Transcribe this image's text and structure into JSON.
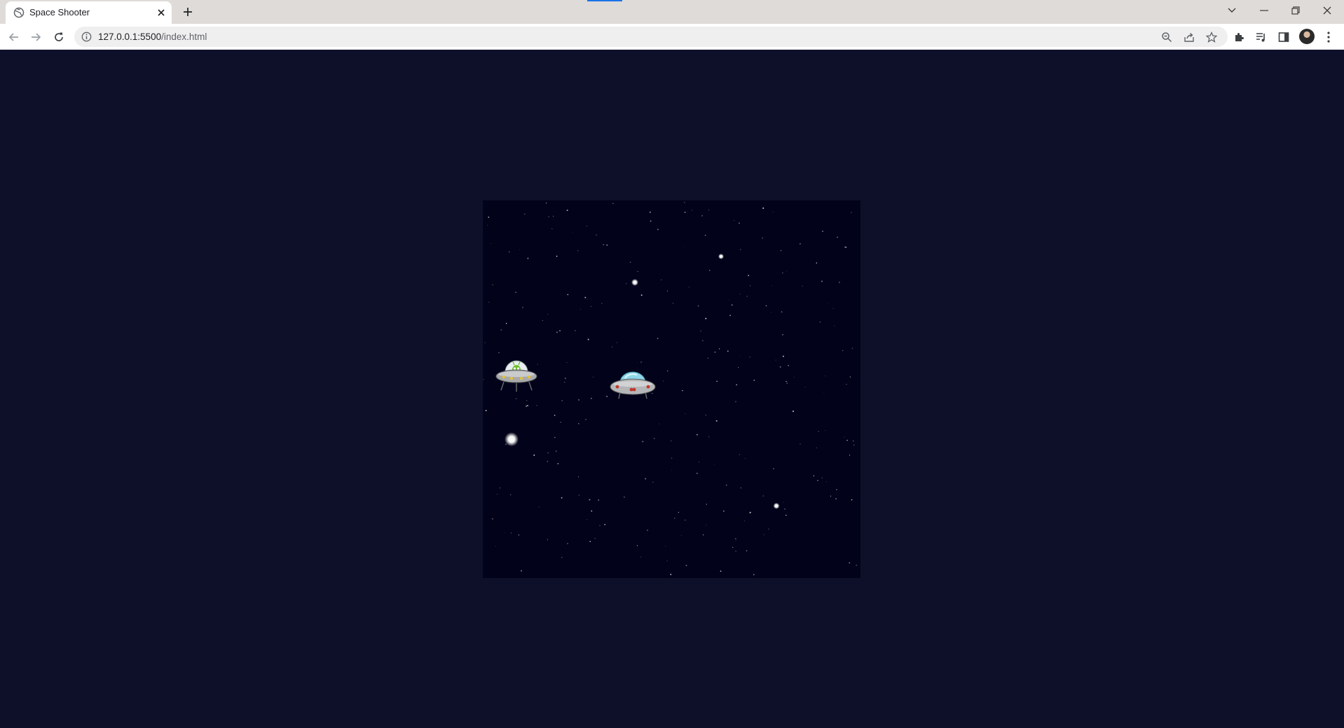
{
  "browser": {
    "tab_title": "Space Shooter",
    "url_host": "127.0.0.1:5500",
    "url_path": "/index.html"
  },
  "game": {
    "title": "Space Shooter",
    "enemy": {
      "sprite": "alien-ufo-icon"
    },
    "player": {
      "sprite": "player-ufo-icon"
    },
    "projectiles": [
      "glowing-orb",
      "glowing-orb",
      "glowing-orb",
      "glowing-orb"
    ],
    "colors": {
      "page_background": "#0e102a",
      "canvas_background": "#02031a",
      "star": "#ffffff"
    }
  }
}
